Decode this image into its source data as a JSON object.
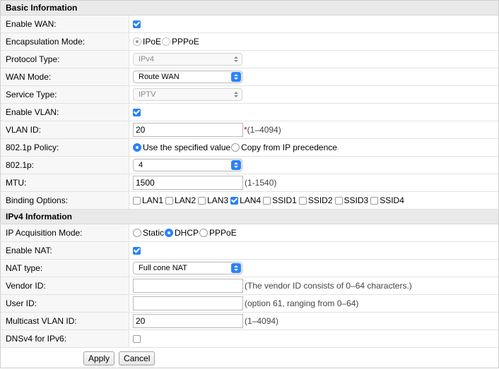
{
  "basic": {
    "header": "Basic Information",
    "enable_wan": {
      "label": "Enable WAN:",
      "checked": true
    },
    "encapsulation": {
      "label": "Encapsulation Mode:",
      "options": [
        "IPoE",
        "PPPoE"
      ],
      "selected": "IPoE"
    },
    "protocol": {
      "label": "Protocol Type:",
      "value": "IPv4"
    },
    "wan_mode": {
      "label": "WAN Mode:",
      "value": "Route WAN"
    },
    "service_type": {
      "label": "Service Type:",
      "value": "IPTV"
    },
    "enable_vlan": {
      "label": "Enable VLAN:",
      "checked": true
    },
    "vlan_id": {
      "label": "VLAN ID:",
      "value": "20",
      "required": "*",
      "hint": "(1–4094)"
    },
    "policy": {
      "label": "802.1p Policy:",
      "options": [
        "Use the specified value",
        "Copy from IP precedence"
      ],
      "selected": "Use the specified value"
    },
    "p8021": {
      "label": "802.1p:",
      "value": "4"
    },
    "mtu": {
      "label": "MTU:",
      "value": "1500",
      "hint": "(1-1540)"
    },
    "binding": {
      "label": "Binding Options:",
      "options": [
        "LAN1",
        "LAN2",
        "LAN3",
        "LAN4",
        "SSID1",
        "SSID2",
        "SSID3",
        "SSID4"
      ],
      "checked": [
        "LAN4"
      ]
    }
  },
  "ipv4": {
    "header": "IPv4 Information",
    "acq_mode": {
      "label": "IP Acquisition Mode:",
      "options": [
        "Static",
        "DHCP",
        "PPPoE"
      ],
      "selected": "DHCP"
    },
    "enable_nat": {
      "label": "Enable NAT:",
      "checked": true
    },
    "nat_type": {
      "label": "NAT type:",
      "value": "Full cone NAT"
    },
    "vendor_id": {
      "label": "Vendor ID:",
      "value": "",
      "hint": "(The vendor ID consists of 0–64 characters.)"
    },
    "user_id": {
      "label": "User ID:",
      "value": "",
      "hint": "(option 61, ranging from 0–64)"
    },
    "mcast_vlan": {
      "label": "Multicast VLAN ID:",
      "value": "20",
      "hint": "(1–4094)"
    },
    "dnsv4": {
      "label": "DNSv4 for IPv6:",
      "checked": false
    }
  },
  "buttons": {
    "apply": "Apply",
    "cancel": "Cancel"
  },
  "colors": {
    "accent": "#2b83f6",
    "header_bg": "#e9e9e9",
    "required": "#e10000"
  }
}
